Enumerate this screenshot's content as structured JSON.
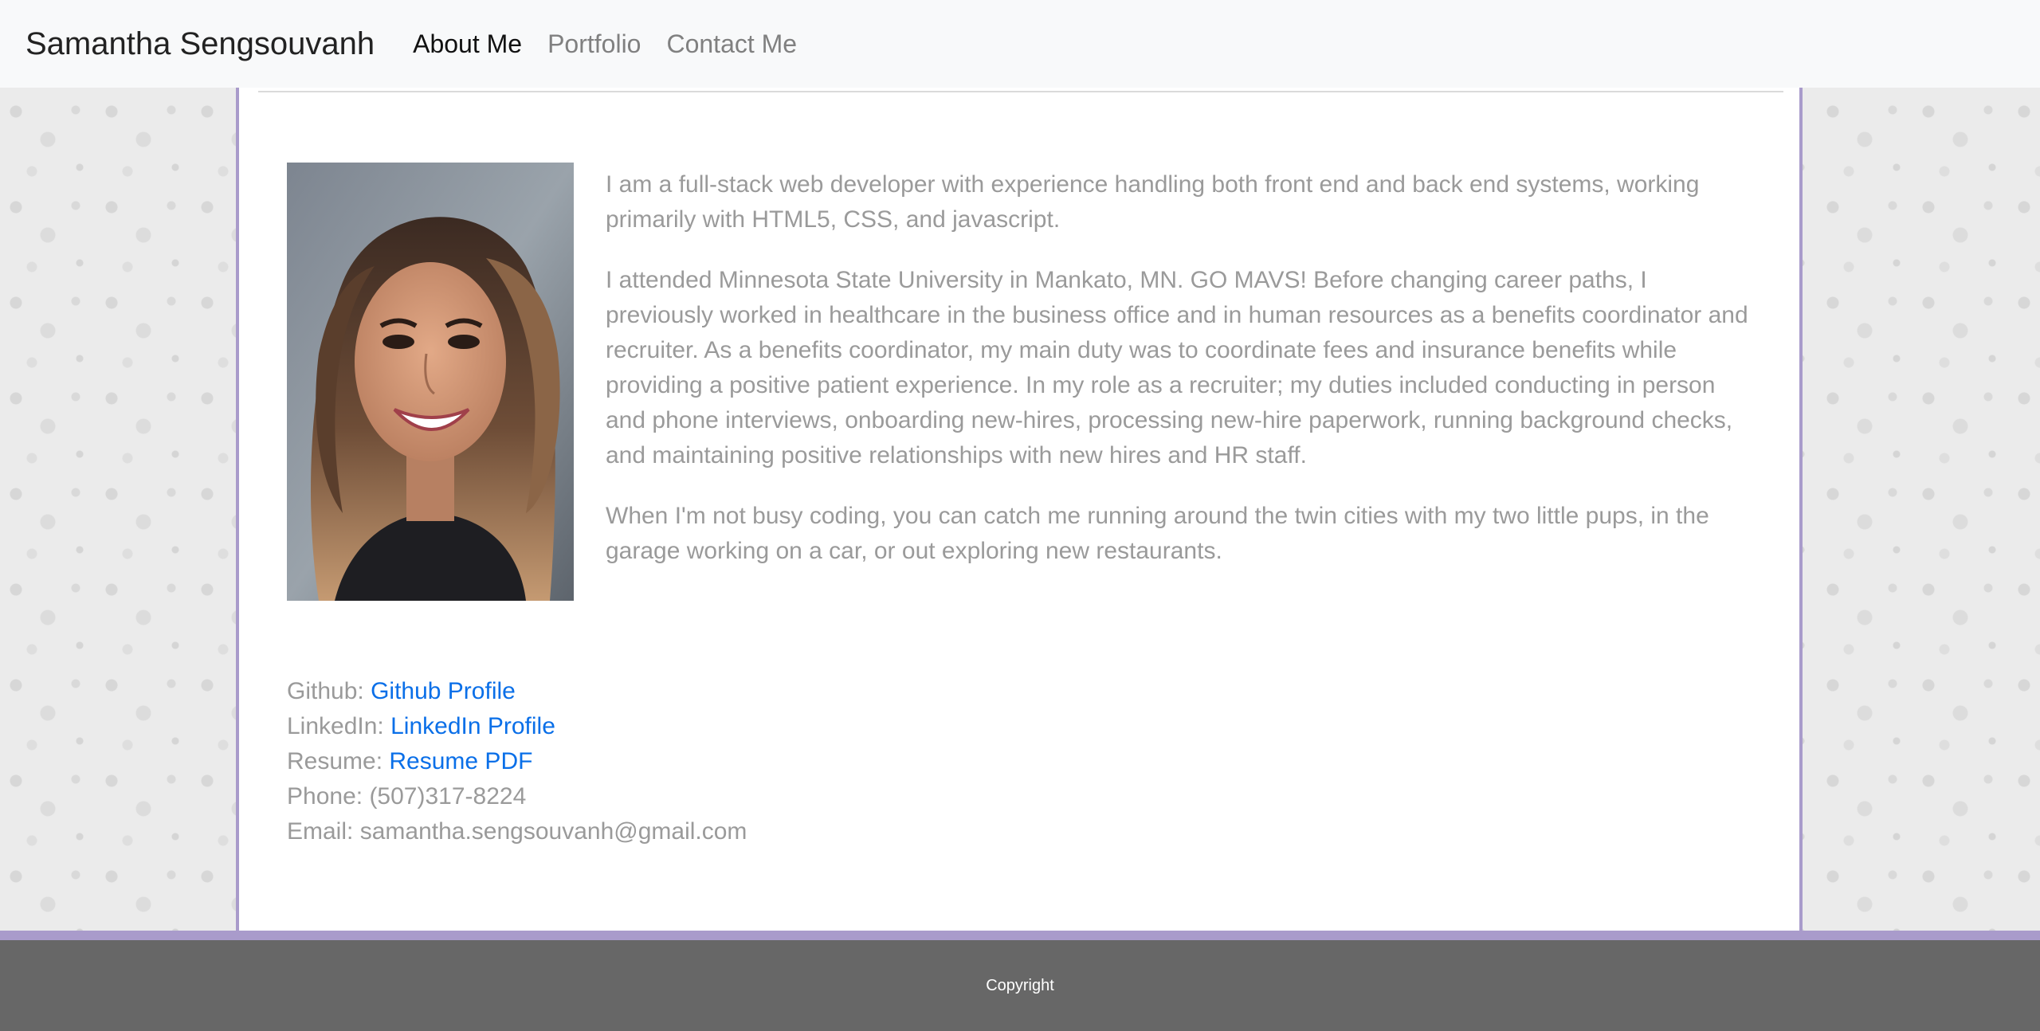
{
  "navbar": {
    "brand": "Samantha Sengsouvanh",
    "links": [
      {
        "label": "About Me",
        "active": true
      },
      {
        "label": "Portfolio",
        "active": false
      },
      {
        "label": "Contact Me",
        "active": false
      }
    ]
  },
  "about": {
    "paragraphs": [
      "I am a full-stack web developer with experience handling both front end and back end systems, working primarily with HTML5, CSS, and javascript.",
      "I attended Minnesota State University in Mankato, MN. GO MAVS! Before changing career paths, I previously worked in healthcare in the business office and in human resources as a benefits coordinator and recruiter. As a benefits coordinator, my main duty was to coordinate fees and insurance benefits while providing a positive patient experience. In my role as a recruiter; my duties included conducting in person and phone interviews, onboarding new-hires, processing new-hire paperwork, running background checks, and maintaining positive relationships with new hires and HR staff.",
      "When I'm not busy coding, you can catch me running around the twin cities with my two little pups, in the garage working on a car, or out exploring new restaurants."
    ]
  },
  "contact": {
    "github_label": "Github:",
    "github_link": "Github Profile",
    "linkedin_label": "LinkedIn:",
    "linkedin_link": "LinkedIn Profile",
    "resume_label": "Resume:",
    "resume_link": "Resume PDF",
    "phone_label": "Phone:",
    "phone_value": "(507)317-8224",
    "email_label": "Email:",
    "email_value": "samantha.sengsouvanh@gmail.com"
  },
  "footer": {
    "text": "Copyright"
  },
  "colors": {
    "accent": "#a99bcb",
    "link": "#0a6fe8",
    "footer_bg": "#676767"
  }
}
